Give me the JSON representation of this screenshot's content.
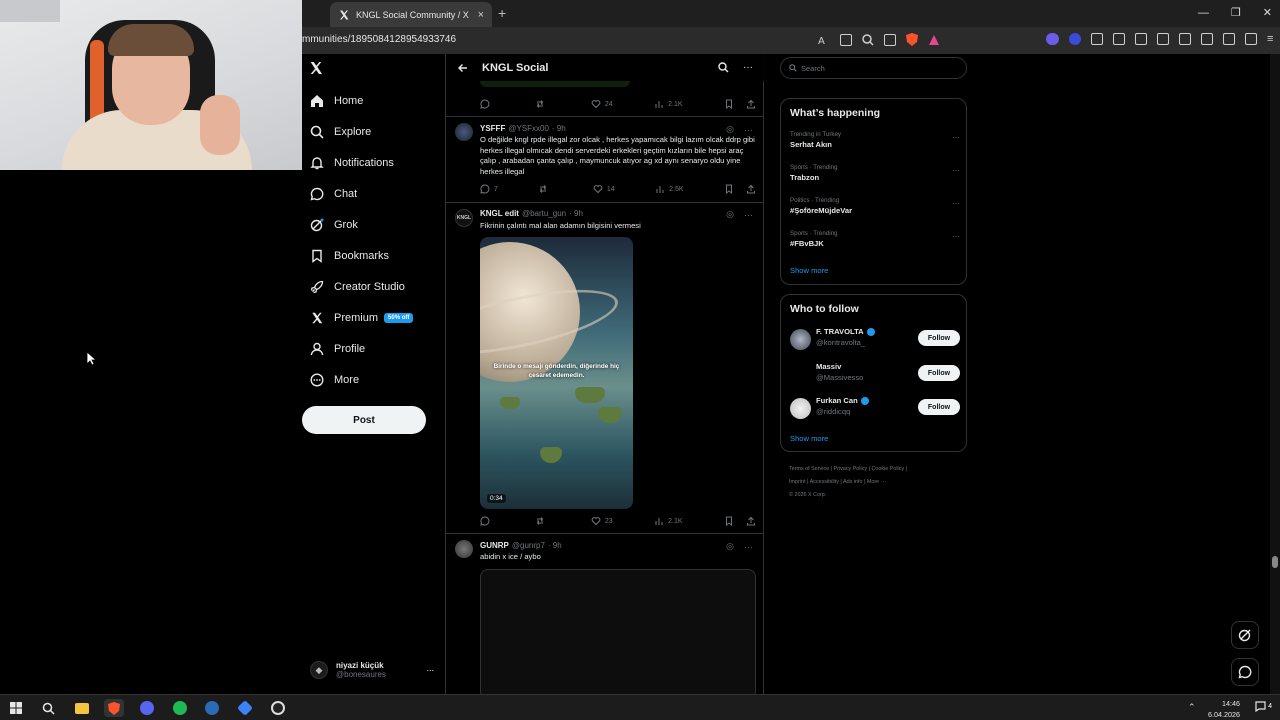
{
  "browser": {
    "tab_title": "KNGL Social Community / X",
    "url": "mmunities/1895084128954933746",
    "new_tab": "+",
    "close_tab": "×"
  },
  "nav": {
    "items": [
      {
        "label": "Home",
        "icon": "home-icon"
      },
      {
        "label": "Explore",
        "icon": "search-icon"
      },
      {
        "label": "Notifications",
        "icon": "bell-icon"
      },
      {
        "label": "Chat",
        "icon": "chat-icon"
      },
      {
        "label": "Grok",
        "icon": "grok-icon"
      },
      {
        "label": "Bookmarks",
        "icon": "bookmark-icon"
      },
      {
        "label": "Creator Studio",
        "icon": "rocket-icon"
      },
      {
        "label": "Premium",
        "icon": "x-logo-icon"
      },
      {
        "label": "Profile",
        "icon": "person-icon"
      },
      {
        "label": "More",
        "icon": "more-circle-icon"
      }
    ],
    "premium_badge": "50% off",
    "post_button": "Post"
  },
  "account": {
    "name": "niyazi küçük",
    "handle": "@bonesaures",
    "more": "..."
  },
  "feed": {
    "title": "KNGL Social",
    "posts": [
      {
        "reply": "",
        "repost": "",
        "likes": "24",
        "views": "2.1K"
      },
      {
        "name": "YSFFF",
        "handle": "@YSFxx00",
        "time": "· 9h",
        "text": "O değilde kngl rpde illegal zor olcak , herkes yapamıcak bilgi lazım olcak ddrp gibi herkes illegal olmıcak dendi  serverdeki erkekleri geçtim kızların bile hepsi araç çalıp , arabadan çanta çalıp , maymuncuk atıyor ag xd aynı senaryo oldu yine herkes illegal",
        "reply": "7",
        "repost": "",
        "likes": "14",
        "views": "2.5K"
      },
      {
        "name": "KNGL edit",
        "handle": "@bartu_gun",
        "time": "· 9h",
        "text": "Fikrinin çalıntı mal alan adamın bilgisini vermesi",
        "media_caption": "Birinde o mesajı gönderdin, diğerinde hiç cesaret edemedin.",
        "duration": "0:34",
        "reply": "",
        "repost": "",
        "likes": "23",
        "views": "2.1K"
      },
      {
        "name": "GUNRP",
        "handle": "@gunrp7",
        "time": "· 9h",
        "text": "abidin x ice / aybo"
      }
    ]
  },
  "right": {
    "search_placeholder": "Search",
    "whats_happening": "What’s happening",
    "trends": [
      {
        "meta": "Trending in Turkey",
        "name": "Serhat Akın"
      },
      {
        "meta": "Sports · Trending",
        "name": "Trabzon"
      },
      {
        "meta": "Politics · Trending",
        "name": "#ŞoföreMüjdeVar"
      },
      {
        "meta": "Sports · Trending",
        "name": "#FBvBJK"
      }
    ],
    "show_more": "Show more",
    "who_to_follow": "Who to follow",
    "follow_suggestions": [
      {
        "name": "F. TRAVOLTA",
        "handle": "@kontravolta_",
        "verified": true
      },
      {
        "name": "Massiv",
        "handle": "@Massivesso",
        "verified": false
      },
      {
        "name": "Furkan Can",
        "handle": "@riddicqq",
        "verified": true
      }
    ],
    "follow_label": "Follow",
    "footer": {
      "line1": "Terms of Service  |  Privacy Policy  |  Cookie Policy  |",
      "line2": "Imprint  |  Accessibility  |  Ads info  |  More ···",
      "line3": "© 2026 X Corp."
    }
  },
  "taskbar": {
    "time": "14:46",
    "date": "6.04.2026",
    "notification_count": "4"
  },
  "colors": {
    "accent": "#1d9bf0",
    "background": "#000000",
    "border": "#2f3336",
    "muted_text": "#71767b"
  }
}
